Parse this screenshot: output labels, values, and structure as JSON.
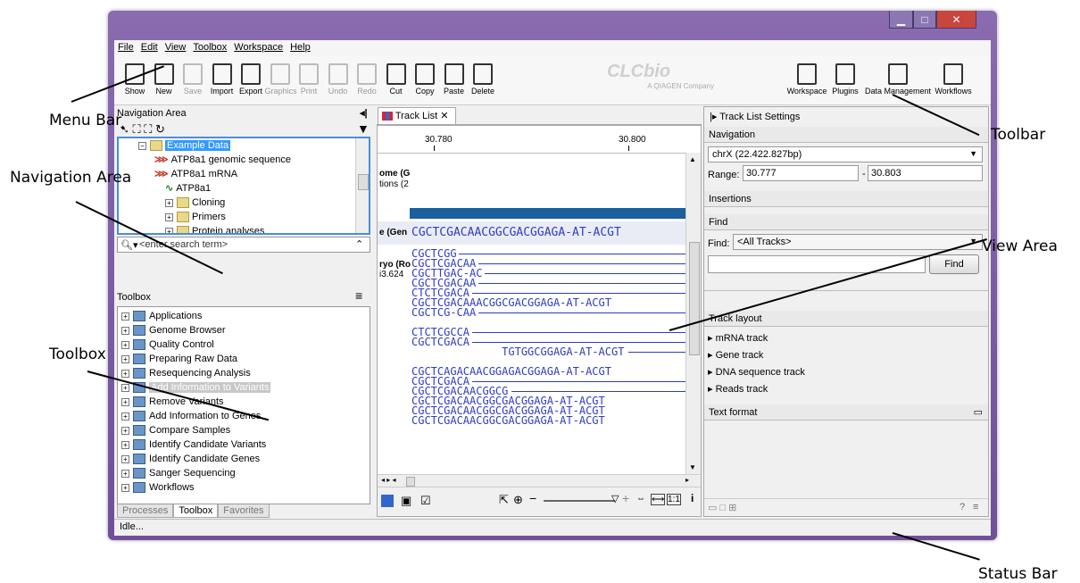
{
  "menubar": {
    "items": [
      "File",
      "Edit",
      "View",
      "Toolbox",
      "Workspace",
      "Help"
    ]
  },
  "toolbar": {
    "left": [
      {
        "label": "Show",
        "icon": "show-icon",
        "disabled": false
      },
      {
        "label": "New",
        "icon": "new-icon",
        "disabled": false
      },
      {
        "label": "Save",
        "icon": "save-icon",
        "disabled": true
      },
      {
        "label": "Import",
        "icon": "import-icon",
        "disabled": false
      },
      {
        "label": "Export",
        "icon": "export-icon",
        "disabled": false
      },
      {
        "label": "Graphics",
        "icon": "graphics-icon",
        "disabled": true
      },
      {
        "label": "Print",
        "icon": "print-icon",
        "disabled": true
      },
      {
        "label": "Undo",
        "icon": "undo-icon",
        "disabled": true
      },
      {
        "label": "Redo",
        "icon": "redo-icon",
        "disabled": true
      },
      {
        "label": "Cut",
        "icon": "cut-icon",
        "disabled": false
      },
      {
        "label": "Copy",
        "icon": "copy-icon",
        "disabled": false
      },
      {
        "label": "Paste",
        "icon": "paste-icon",
        "disabled": false
      },
      {
        "label": "Delete",
        "icon": "delete-icon",
        "disabled": false
      }
    ],
    "right": [
      {
        "label": "Workspace",
        "icon": "workspace-icon"
      },
      {
        "label": "Plugins",
        "icon": "plugins-icon"
      },
      {
        "label": "Data Management",
        "icon": "data-management-icon"
      },
      {
        "label": "Workflows",
        "icon": "workflows-icon"
      }
    ],
    "logo": "CLCbio",
    "logo_sub": "A QIAGEN Company"
  },
  "navigation": {
    "title": "Navigation Area",
    "items": [
      {
        "label": "Example Data",
        "selected": true
      },
      {
        "label": "ATP8a1 genomic sequence"
      },
      {
        "label": "ATP8a1 mRNA"
      },
      {
        "label": "ATP8a1"
      },
      {
        "label": "Cloning"
      },
      {
        "label": "Primers"
      },
      {
        "label": "Protein analyses"
      }
    ],
    "search_placeholder": "<enter search term>"
  },
  "toolbox": {
    "title": "Toolbox",
    "items": [
      "Applications",
      "Genome Browser",
      "Quality Control",
      "Preparing Raw Data",
      "Resequencing Analysis",
      "Add Information to Variants",
      "Remove Variants",
      "Add Information to Genes",
      "Compare Samples",
      "Identify Candidate Variants",
      "Identify Candidate Genes",
      "Sanger Sequencing",
      "Workflows"
    ],
    "selected_index": 5,
    "tabs": [
      "Processes",
      "Toolbox",
      "Favorites"
    ],
    "active_tab": 1
  },
  "view": {
    "tab_label": "Track List",
    "ruler": [
      "30.780",
      "30.800"
    ],
    "labels": [
      "ome (G",
      "tions (2",
      "e (Gen",
      "ryo (Ro",
      "i3.624"
    ],
    "seq_main": "CGCTCGACAACGGCGACGGAGA-AT-ACGT",
    "reads": [
      "CGCTCGG",
      "CGCTCGACAA",
      "CGCTTGAC-AC",
      "CGCTCGACAA",
      "CTCTCGACA",
      "CGCTCGACAAACGGCGACGGAGA-AT-ACGT",
      "CGCTCG-CAA",
      "",
      "CTCTCGCCA",
      "CGCTCGACA",
      "              TGTGGCGGAGA-AT-ACGT",
      "",
      "CGCTCAGACAACGGAGACGGAGA-AT-ACGT",
      "CGCTCGACA",
      "CGCTCGACAACGGCG",
      "CGCTCGACAACGGCGACGGAGA-AT-ACGT",
      "CGCTCGACAACGGCGACGGAGA-AT-ACGT",
      "CGCTCGACAACGGCGACGGAGA-AT-ACGT"
    ]
  },
  "settings": {
    "title": "Track List Settings",
    "navigation_label": "Navigation",
    "chromosome": "chrX (22.422.827bp)",
    "range_label": "Range:",
    "range_from": "30.777",
    "range_to": "30.803",
    "insertions_label": "Insertions",
    "find_label": "Find",
    "find_field_label": "Find:",
    "find_select": "<All Tracks>",
    "find_button": "Find",
    "track_layout_label": "Track layout",
    "tracks": [
      "mRNA track",
      "Gene track",
      "DNA sequence track",
      "Reads track"
    ],
    "text_format_label": "Text format"
  },
  "status": {
    "text": "Idle..."
  },
  "annotations": [
    "Menu Bar",
    "Toolbar",
    "Navigation Area",
    "View Area",
    "Toolbox",
    "Status Bar"
  ],
  "colors": {
    "selection": "#3399ff",
    "seq": "#2f3cc0",
    "title_purple": "#7b5aa6"
  }
}
